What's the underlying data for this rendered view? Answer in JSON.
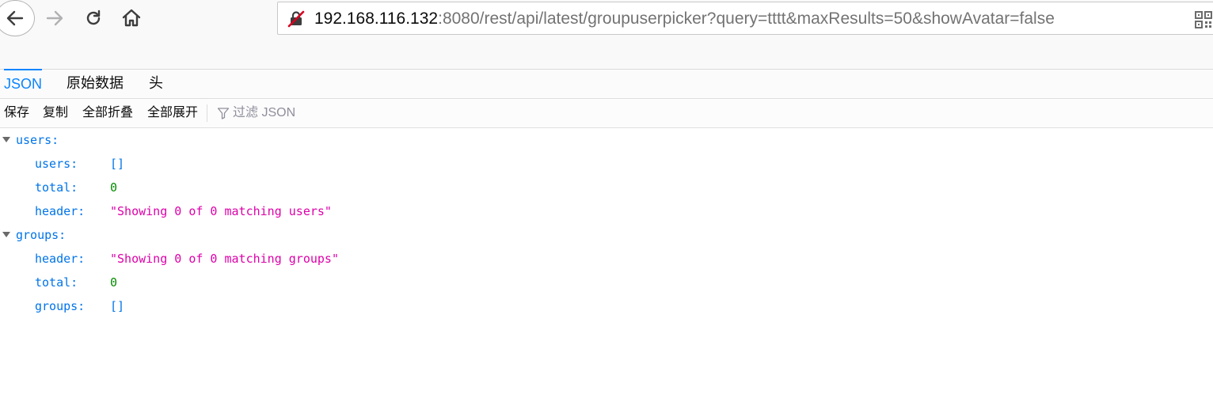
{
  "browser": {
    "url_host": "192.168.116.132",
    "url_rest": ":8080/rest/api/latest/groupuserpicker?query=tttt&maxResults=50&showAvatar=false",
    "icons": [
      "back-arrow-icon",
      "forward-arrow-icon",
      "reload-icon",
      "home-icon",
      "insecure-lock-icon",
      "qr-code-icon"
    ]
  },
  "tabs": [
    {
      "label": "JSON",
      "active": true
    },
    {
      "label": "原始数据",
      "active": false
    },
    {
      "label": "头",
      "active": false
    }
  ],
  "json_toolbar": {
    "save": "保存",
    "copy": "复制",
    "collapse_all": "全部折叠",
    "expand_all": "全部展开",
    "filter_placeholder": "过滤 JSON"
  },
  "tree": {
    "users_key": "users:",
    "users": {
      "users_key": "users:",
      "users_val": "[]",
      "total_key": "total:",
      "total_val": "0",
      "header_key": "header:",
      "header_val": "\"Showing 0 of 0 matching users\""
    },
    "groups_key": "groups:",
    "groups": {
      "header_key": "header:",
      "header_val": "\"Showing 0 of 0 matching groups\"",
      "total_key": "total:",
      "total_val": "0",
      "groups_key": "groups:",
      "groups_val": "[]"
    }
  },
  "colors": {
    "key": "#0074e8",
    "number": "#058b00",
    "string": "#dd00a9",
    "active_tab": "#0a84ff"
  }
}
